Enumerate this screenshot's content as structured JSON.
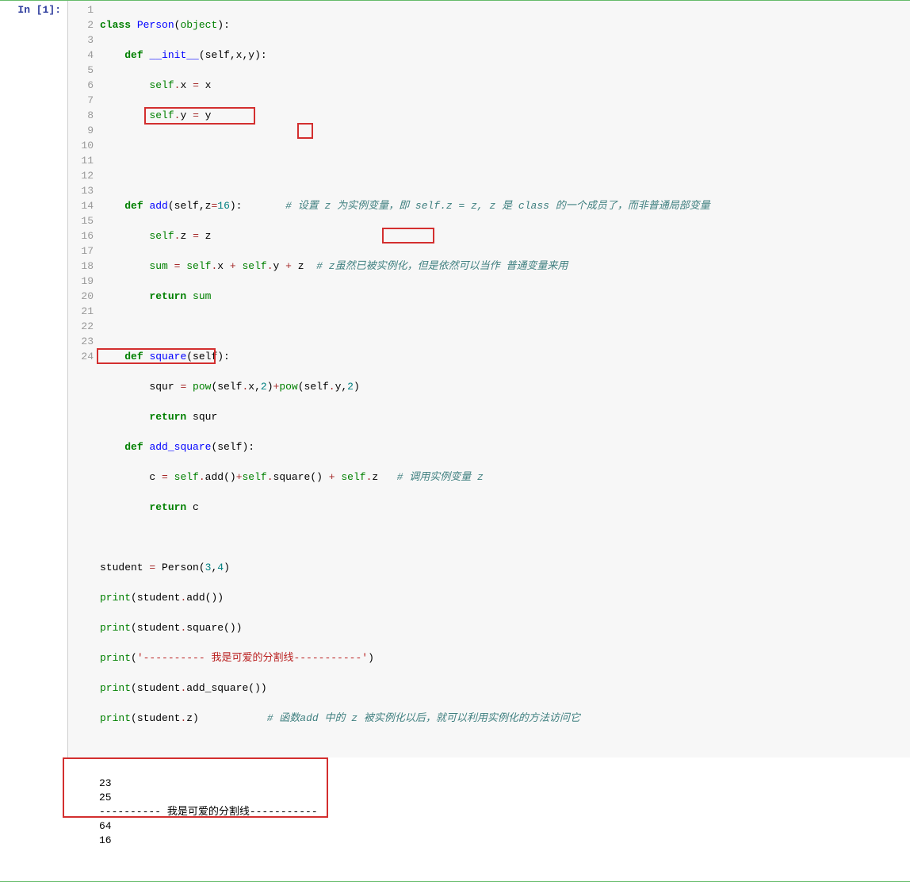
{
  "prompt": "In [1]:",
  "gutter": [
    "1",
    "2",
    "3",
    "4",
    "5",
    "6",
    "7",
    "8",
    "9",
    "10",
    "11",
    "12",
    "13",
    "14",
    "15",
    "16",
    "17",
    "18",
    "19",
    "20",
    "21",
    "22",
    "23",
    "24"
  ],
  "code": {
    "l1": {
      "kw1": "class",
      "name": "Person",
      "paren_l": "(",
      "arg": "object",
      "paren_r": "):"
    },
    "l2": {
      "indent": "    ",
      "kw": "def",
      "name": "__init__",
      "sig": "(self,x,y):"
    },
    "l3": {
      "indent": "        ",
      "lhs": "self",
      "dot": ".",
      "attr": "x ",
      "op": "= ",
      "rhs": "x"
    },
    "l4": {
      "indent": "        ",
      "lhs": "self",
      "dot": ".",
      "attr": "y ",
      "op": "= ",
      "rhs": "y"
    },
    "l5": "",
    "l6": "",
    "l7": {
      "indent": "    ",
      "kw": "def",
      "name": "add",
      "sig_pre": "(self,z",
      "op": "=",
      "num": "16",
      "sig_post": "):",
      "pad": "       ",
      "comment": "# 设置 z 为实例变量，即 self.z = z, z 是 class 的一个成员了，而非普通局部变量"
    },
    "l8": {
      "indent": "        ",
      "lhs": "self",
      "dot": ".",
      "attr": "z ",
      "op": "= ",
      "rhs": "z"
    },
    "l9": {
      "indent": "        ",
      "sumv": "sum ",
      "op1": "= ",
      "s1": "self",
      "d1": ".",
      "a1": "x ",
      "plus1": "+ ",
      "s2": "self",
      "d2": ".",
      "a2": "y ",
      "plus2": "+ ",
      "zv": "z",
      "pad": "  ",
      "comment": "# z虽然已被实例化，但是依然可以当作 普通变量来用"
    },
    "l10": {
      "indent": "        ",
      "kw": "return",
      "pad": " ",
      "val": "sum"
    },
    "l11": "",
    "l12": {
      "indent": "    ",
      "kw": "def",
      "name": "square",
      "sig": "(self):"
    },
    "l13": {
      "indent": "        ",
      "lhs": "squr ",
      "op": "= ",
      "fn": "pow",
      "p1": "(self",
      "d1": ".",
      "a1": "x,",
      "n1": "2",
      "mid": ")",
      "plus": "+",
      "fn2": "pow",
      "p2": "(self",
      "d2": ".",
      "a2": "y,",
      "n2": "2",
      "end": ")"
    },
    "l14": {
      "indent": "        ",
      "kw": "return",
      "pad": " ",
      "val": "squr"
    },
    "l15": {
      "indent": "    ",
      "kw": "def",
      "name": "add_square",
      "sig": "(self):"
    },
    "l16": {
      "indent": "        ",
      "lhs": "c ",
      "op": "= ",
      "s1": "self",
      "d1": ".",
      "call1": "add()",
      "plus1": "+",
      "s2": "self",
      "d2": ".",
      "call2": "square() ",
      "plus2": "+ ",
      "s3": "self",
      "d3": ".",
      "a3": "z",
      "pad": "   ",
      "comment": "# 调用实例变量 z"
    },
    "l17": {
      "indent": "        ",
      "kw": "return",
      "pad": " ",
      "val": "c"
    },
    "l18": "",
    "l19": {
      "lhs": "student ",
      "op": "= ",
      "cls": "Person(",
      "n1": "3",
      "comma": ",",
      "n2": "4",
      "end": ")"
    },
    "l20": {
      "fn": "print",
      "p1": "(student",
      "d": ".",
      "call": "add())"
    },
    "l21": {
      "fn": "print",
      "p1": "(student",
      "d": ".",
      "call": "square())"
    },
    "l22": {
      "fn": "print",
      "p1": "(",
      "str": "'---------- 我是可爱的分割线-----------'",
      "end": ")"
    },
    "l23": {
      "fn": "print",
      "p1": "(student",
      "d": ".",
      "call": "add_square())"
    },
    "l24": {
      "fn": "print",
      "p1": "(student",
      "d": ".",
      "attr": "z)",
      "pad": "           ",
      "comment": "# 函数add 中的 z 被实例化以后，就可以利用实例化的方法访问它"
    }
  },
  "output": {
    "o1": "23",
    "o2": "25",
    "o3": "---------- 我是可爱的分割线-----------",
    "o4": "64",
    "o5": "16"
  }
}
